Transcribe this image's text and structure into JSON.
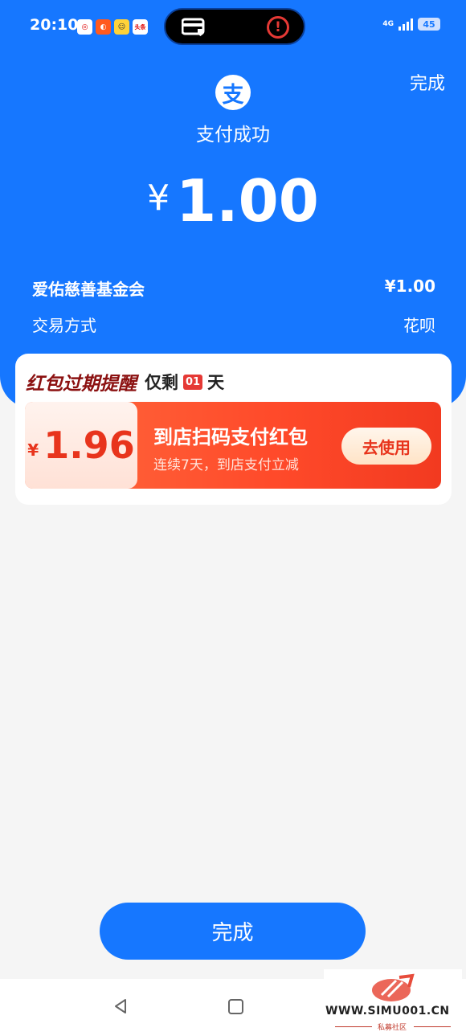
{
  "status_bar": {
    "time": "20:10",
    "notif_icons": [
      "app-icon-1",
      "app-icon-2",
      "app-icon-3",
      "头条"
    ],
    "network": "4G",
    "battery": "45"
  },
  "header": {
    "done_label": "完成",
    "logo_glyph": "支",
    "status_text": "支付成功",
    "currency": "¥",
    "amount": "1.00"
  },
  "details": [
    {
      "label": "爱佑慈善基金会",
      "value": "¥1.00"
    },
    {
      "label": "交易方式",
      "value": "花呗"
    }
  ],
  "coupon_card": {
    "reminder_title": "红包过期提醒",
    "remaining_prefix": "仅剩",
    "remaining_days": "01",
    "remaining_unit": "天",
    "currency": "¥",
    "coupon_value": "1.96",
    "coupon_title": "到店扫码支付红包",
    "coupon_desc": "连续7天，到店支付立减",
    "use_label": "去使用"
  },
  "footer": {
    "done_label": "完成"
  },
  "watermark": {
    "url": "WWW.SIMU001.CN",
    "sub": "私募社区"
  },
  "colors": {
    "primary": "#1677ff",
    "coupon_red": "#ff4a2a",
    "reminder_title": "#8b1010"
  }
}
